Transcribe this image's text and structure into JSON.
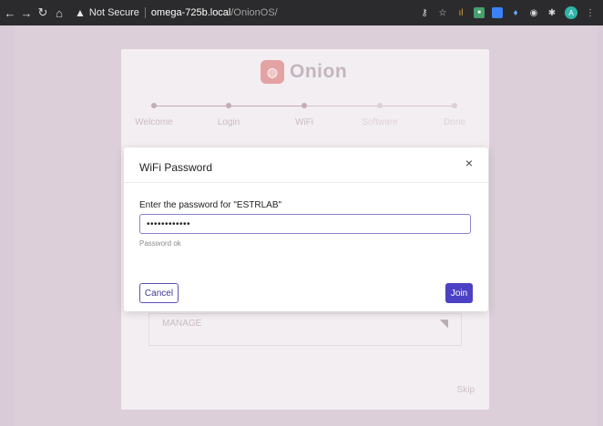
{
  "browser": {
    "nav": {
      "back": "←",
      "forward": "→",
      "reload": "↻",
      "home": "⌂"
    },
    "security_warning_icon": "warning-triangle-icon",
    "security_text": "Not Secure",
    "url_host": "omega-725b.local",
    "url_path": "/OnionOS/",
    "tray_icons": [
      "key-icon",
      "star-icon",
      "extension-icons",
      "profile-avatar",
      "menu-icon"
    ],
    "avatar_letter": "A"
  },
  "app": {
    "logo_text": "Onion",
    "steps": [
      {
        "label": "Welcome",
        "state": "done"
      },
      {
        "label": "Login",
        "state": "done"
      },
      {
        "label": "WiFi",
        "state": "active"
      },
      {
        "label": "Software",
        "state": "pending"
      },
      {
        "label": "Done",
        "state": "pending"
      }
    ],
    "manage_label": "MANAGE",
    "skip_label": "Skip"
  },
  "modal": {
    "title": "WiFi Password",
    "close": "×",
    "prompt": "Enter the password for \"ESTRLAB\"",
    "password_value": "••••••••••••",
    "hint": "Password ok",
    "cancel_label": "Cancel",
    "join_label": "Join"
  },
  "colors": {
    "accent": "#4c40c4",
    "field_border": "#8a85cf",
    "backdrop": "#d9ccd8"
  }
}
